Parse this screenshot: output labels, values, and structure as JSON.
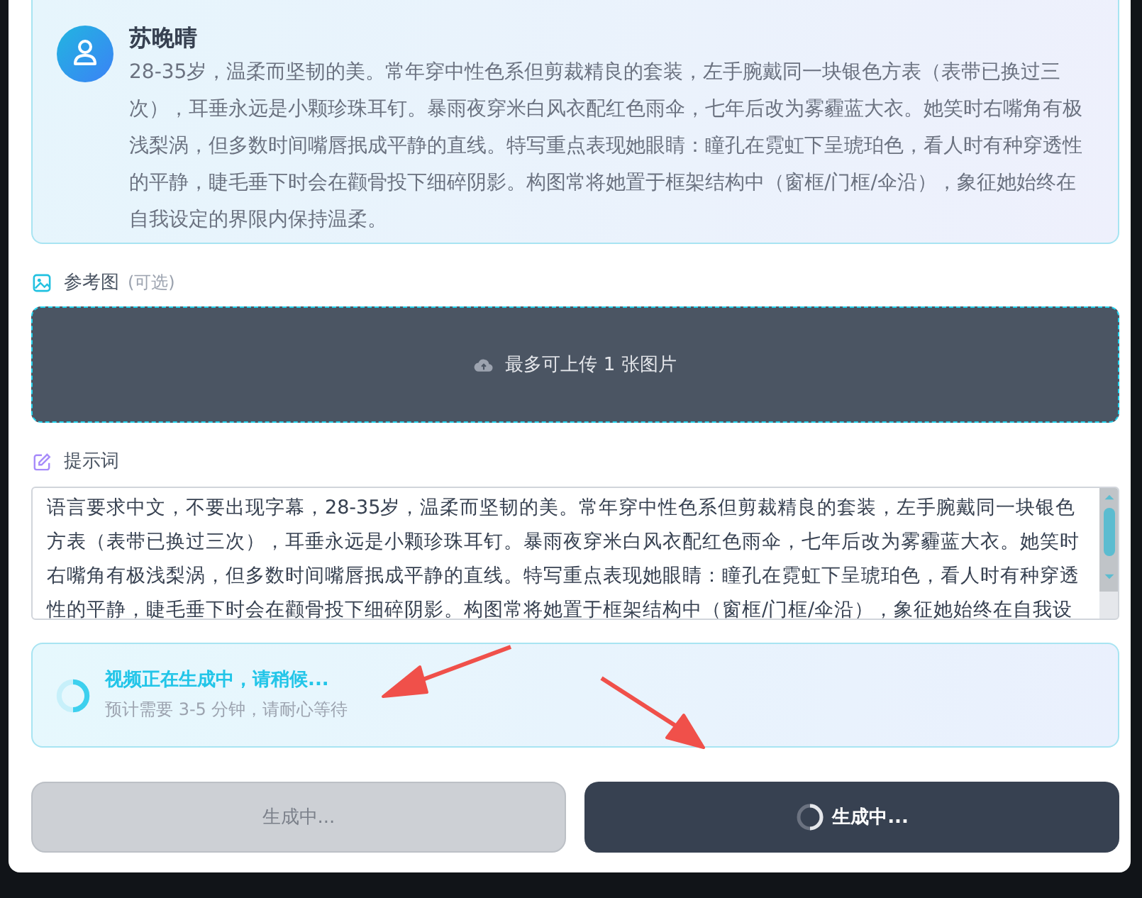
{
  "character": {
    "name": "苏晚晴",
    "description": "28-35岁，温柔而坚韧的美。常年穿中性色系但剪裁精良的套装，左手腕戴同一块银色方表（表带已换过三次），耳垂永远是小颗珍珠耳钉。暴雨夜穿米白风衣配红色雨伞，七年后改为雾霾蓝大衣。她笑时右嘴角有极浅梨涡，但多数时间嘴唇抿成平静的直线。特写重点表现她眼睛：瞳孔在霓虹下呈琥珀色，看人时有种穿透性的平静，睫毛垂下时会在颧骨投下细碎阴影。构图常将她置于框架结构中（窗框/门框/伞沿），象征她始终在自我设定的界限内保持温柔。"
  },
  "reference": {
    "label": "参考图",
    "hint": "(可选)",
    "upload_text": "最多可上传 1 张图片"
  },
  "prompt": {
    "label": "提示词",
    "value": "语言要求中文，不要出现字幕，28-35岁，温柔而坚韧的美。常年穿中性色系但剪裁精良的套装，左手腕戴同一块银色方表（表带已换过三次），耳垂永远是小颗珍珠耳钉。暴雨夜穿米白风衣配红色雨伞，七年后改为雾霾蓝大衣。她笑时右嘴角有极浅梨涡，但多数时间嘴唇抿成平静的直线。特写重点表现她眼睛：瞳孔在霓虹下呈琥珀色，看人时有种穿透性的平静，睫毛垂下时会在颧骨投下细碎阴影。构图常将她置于框架结构中（窗框/门框/伞沿），象征她始终在自我设"
  },
  "status": {
    "title": "视频正在生成中，请稍候...",
    "subtitle": "预计需要 3-5 分钟，请耐心等待"
  },
  "buttons": [
    {
      "label": "生成中...",
      "kind": "secondary",
      "disabled": true,
      "loading": false
    },
    {
      "label": "生成中...",
      "kind": "primary",
      "disabled": false,
      "loading": true
    }
  ]
}
